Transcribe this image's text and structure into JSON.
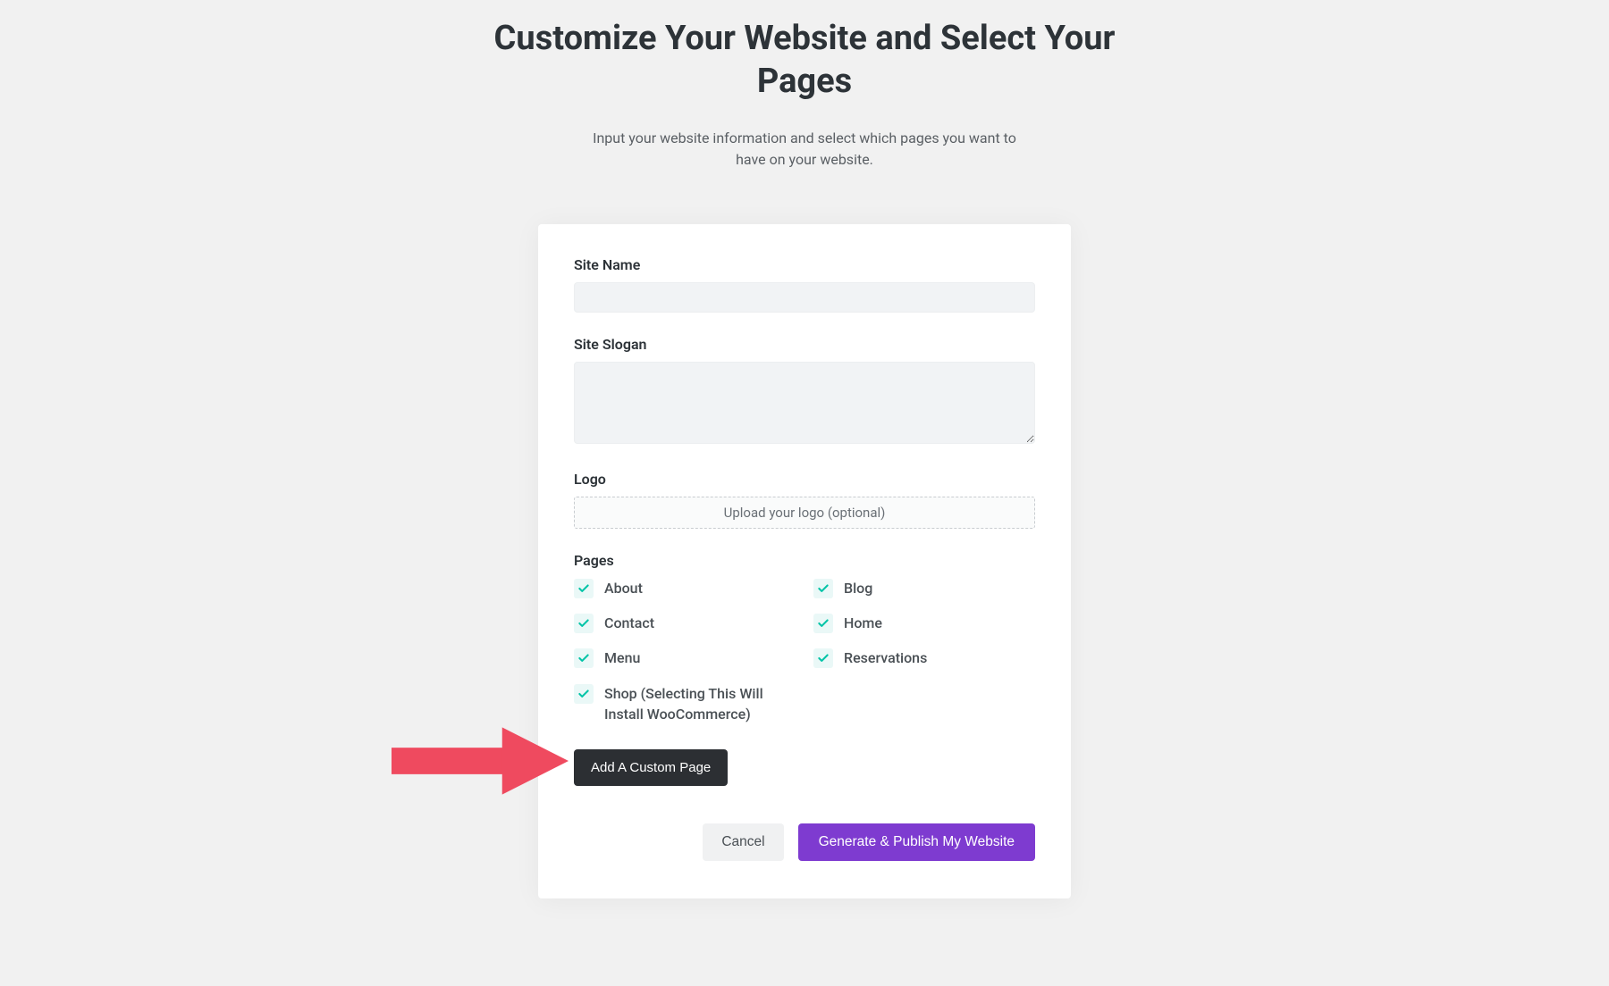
{
  "header": {
    "title": "Customize Your Website and Select Your Pages",
    "subtitle": "Input your website information and select which pages you want to have on your website."
  },
  "form": {
    "site_name": {
      "label": "Site Name",
      "value": ""
    },
    "site_slogan": {
      "label": "Site Slogan",
      "value": ""
    },
    "logo": {
      "label": "Logo",
      "upload_text": "Upload your logo (optional)"
    },
    "pages": {
      "label": "Pages",
      "options": [
        {
          "label": "About",
          "checked": true
        },
        {
          "label": "Blog",
          "checked": true
        },
        {
          "label": "Contact",
          "checked": true
        },
        {
          "label": "Home",
          "checked": true
        },
        {
          "label": "Menu",
          "checked": true
        },
        {
          "label": "Reservations",
          "checked": true
        },
        {
          "label": "Shop (Selecting This Will Install WooCommerce)",
          "checked": true
        }
      ]
    },
    "add_custom_page_label": "Add A Custom Page"
  },
  "actions": {
    "cancel_label": "Cancel",
    "generate_label": "Generate & Publish My Website"
  },
  "colors": {
    "accent_purple": "#7e3bd0",
    "check_teal": "#00c4a7",
    "arrow_red": "#ef4a5f"
  }
}
